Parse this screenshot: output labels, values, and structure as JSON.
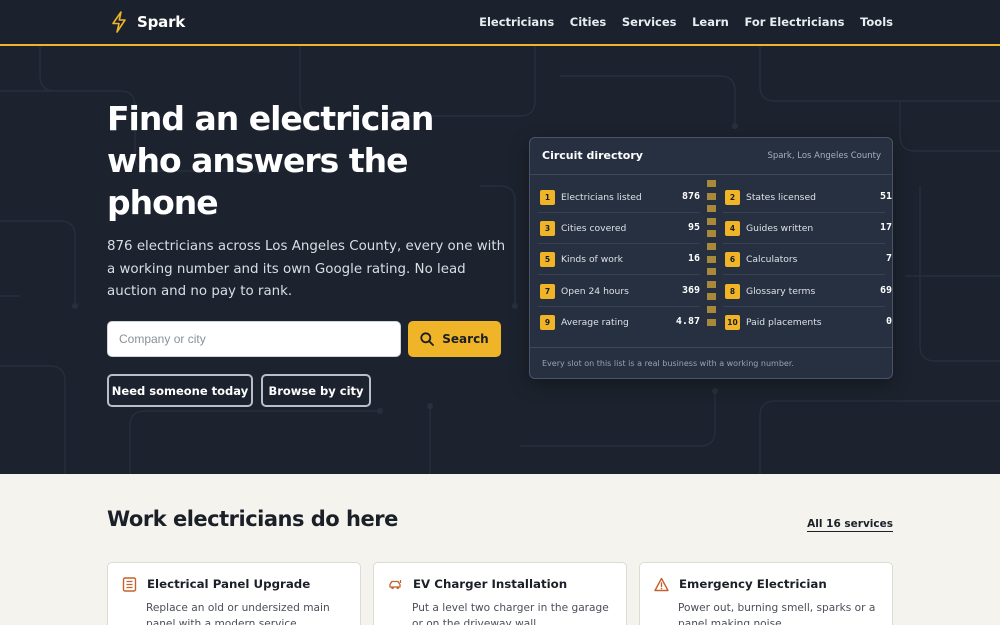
{
  "brand": {
    "name": "Spark"
  },
  "nav": {
    "links": [
      "Electricians",
      "Cities",
      "Services",
      "Learn",
      "For Electricians",
      "Tools"
    ]
  },
  "hero": {
    "title": "Find an electrician who answers the phone",
    "lead": "876 electricians across Los Angeles County, every one with a working number and its own Google rating. No lead auction and no pay to rank.",
    "search": {
      "placeholder": "Company or city",
      "button_label": "Search"
    },
    "buttons": {
      "primary": "Need someone today",
      "secondary": "Browse by city"
    }
  },
  "directory": {
    "title": "Circuit directory",
    "subtitle": "Spark, Los Angeles County",
    "left_rows": [
      {
        "num": "1",
        "label": "Electricians listed",
        "value": "876"
      },
      {
        "num": "3",
        "label": "Cities covered",
        "value": "95"
      },
      {
        "num": "5",
        "label": "Kinds of work",
        "value": "16"
      },
      {
        "num": "7",
        "label": "Open 24 hours",
        "value": "369"
      },
      {
        "num": "9",
        "label": "Average rating",
        "value": "4.87"
      }
    ],
    "right_rows": [
      {
        "num": "2",
        "label": "States licensed",
        "value": "51"
      },
      {
        "num": "4",
        "label": "Guides written",
        "value": "17"
      },
      {
        "num": "6",
        "label": "Calculators",
        "value": "7"
      },
      {
        "num": "8",
        "label": "Glossary terms",
        "value": "69"
      },
      {
        "num": "10",
        "label": "Paid placements",
        "value": "0"
      }
    ],
    "footer": "Every slot on this list is a real business with a working number."
  },
  "services": {
    "title": "Work electricians do here",
    "all_link": "All 16 services",
    "cards": [
      {
        "icon": "panel-icon",
        "title": "Electrical Panel Upgrade",
        "desc": "Replace an old or undersized main panel with a modern service"
      },
      {
        "icon": "car-charger-icon",
        "title": "EV Charger Installation",
        "desc": "Put a level two charger in the garage or on the driveway wall"
      },
      {
        "icon": "warning-icon",
        "title": "Emergency Electrician",
        "desc": "Power out, burning smell, sparks or a panel making noise"
      }
    ]
  },
  "colors": {
    "accent": "#f0b429",
    "hero_bg": "#1d232e",
    "page_bg": "#f4f3ee",
    "icon_accent": "#c4622d"
  }
}
